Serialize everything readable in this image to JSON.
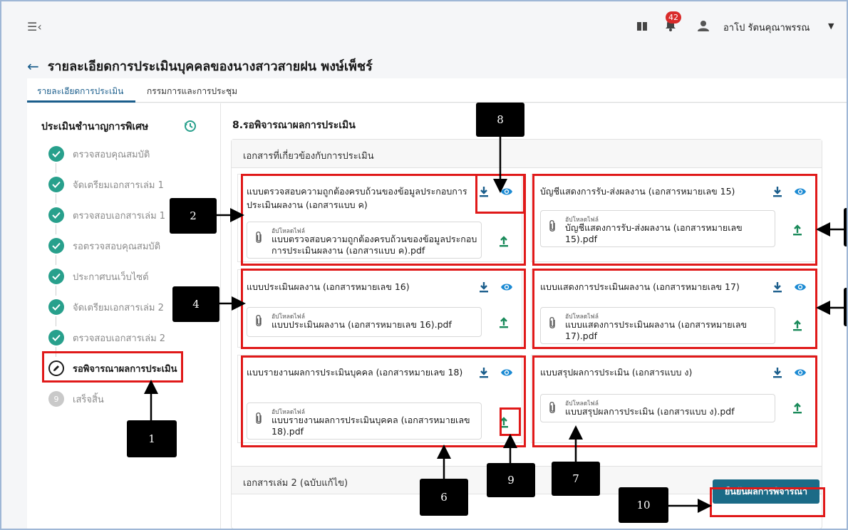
{
  "topbar": {
    "notification_count": "42",
    "user_name": "อาโป รัตนคุณาพรรณ"
  },
  "page": {
    "title": "รายละเอียดการประเมินบุคคลของนางสาวสายฝน พงษ์เพ็ชร์"
  },
  "tabs": [
    {
      "label": "รายละเอียดการประเมิน"
    },
    {
      "label": "กรรมการและการประชุม"
    }
  ],
  "sidebar": {
    "title": "ประเมินชำนาญการพิเศษ",
    "steps": [
      {
        "label": "ตรวจสอบคุณสมบัติ",
        "status": "done"
      },
      {
        "label": "จัดเตรียมเอกสารเล่ม 1",
        "status": "done"
      },
      {
        "label": "ตรวจสอบเอกสารเล่ม 1",
        "status": "done"
      },
      {
        "label": "รอตรวจสอบคุณสมบัติ",
        "status": "done"
      },
      {
        "label": "ประกาศบนเว็บไซต์",
        "status": "done"
      },
      {
        "label": "จัดเตรียมเอกสารเล่ม 2",
        "status": "done"
      },
      {
        "label": "ตรวจสอบเอกสารเล่ม 2",
        "status": "done"
      },
      {
        "label": "รอพิจารณาผลการประเมิน",
        "status": "current"
      },
      {
        "label": "เสร็จสิ้น",
        "status": "pending",
        "number": "9"
      }
    ]
  },
  "main": {
    "section_title": "8.รอพิจารณาผลการประเมิน",
    "docs_header": "เอกสารที่เกี่ยวข้องกับการประเมิน",
    "upload_label": "อัปโหลดไฟล์",
    "documents": [
      {
        "title": "แบบตรวจสอบความถูกต้องครบถ้วนของข้อมูลประกอบการประเมินผลงาน (เอกสารแบบ ค)",
        "file": "แบบตรวจสอบความถูกต้องครบถ้วนของข้อมูลประกอบการประเมินผลงาน (เอกสารแบบ ค).pdf"
      },
      {
        "title": "บัญชีแสดงการรับ-ส่งผลงาน (เอกสารหมายเลข 15)",
        "file": "บัญชีแสดงการรับ-ส่งผลงาน (เอกสารหมายเลข 15).pdf"
      },
      {
        "title": "แบบประเมินผลงาน (เอกสารหมายเลข 16)",
        "file": "แบบประเมินผลงาน (เอกสารหมายเลข 16).pdf"
      },
      {
        "title": "แบบแสดงการประเมินผลงาน (เอกสารหมายเลข 17)",
        "file": "แบบแสดงการประเมินผลงาน (เอกสารหมายเลข 17).pdf"
      },
      {
        "title": "แบบรายงานผลการประเมินบุคคล (เอกสารหมายเลข 18)",
        "file": "แบบรายงานผลการประเมินบุคคล (เอกสารหมายเลข 18).pdf"
      },
      {
        "title": "แบบสรุปผลการประเมิน (เอกสารแบบ ง)",
        "file": "แบบสรุปผลการประเมิน (เอกสารแบบ ง).pdf"
      }
    ],
    "section2_header": "เอกสารเล่ม 2 (ฉบับแก้ไข)",
    "confirm_button": "ยืนยันผลการพิจารณา"
  },
  "callouts": [
    "1",
    "2",
    "4",
    "6",
    "7",
    "8",
    "9",
    "10"
  ],
  "colors": {
    "accent": "#1b5e8c",
    "step_done": "#28a08c",
    "highlight": "#e01919",
    "confirm_button": "#1b6b87"
  }
}
